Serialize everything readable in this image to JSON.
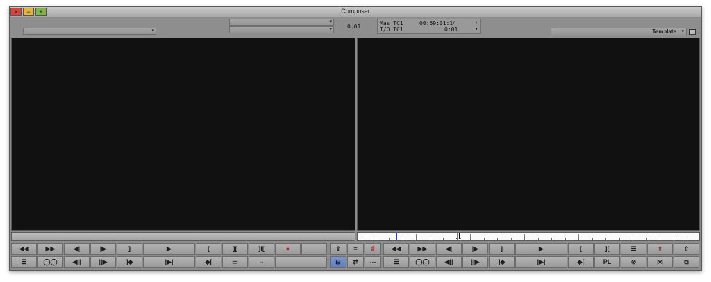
{
  "window": {
    "title": "Composer",
    "close_glyph": "×",
    "minimize_glyph": "−",
    "zoom_glyph": "+"
  },
  "topbar": {
    "source_menu_arrow": "▾",
    "record_menu_arrow": "▾",
    "center_timecode": "0:01",
    "tc1_label": "Mas TC1",
    "tc1_value": "00:59:01:14",
    "tc2_label": "I/O TC1",
    "tc2_value": "0:01",
    "template_label": "Template",
    "template_arrow": "▾"
  },
  "position_bar": {
    "mark_glyph": "][",
    "tick_count": 25
  },
  "source_buttons_row1": [
    {
      "name": "rewind-button",
      "glyph": "◀◀",
      "w": 38
    },
    {
      "name": "fast-forward-button",
      "glyph": "▶▶",
      "w": 38
    },
    {
      "name": "step-back-one-frame-button",
      "glyph": "◀|",
      "w": 38
    },
    {
      "name": "step-forward-one-frame-button",
      "glyph": "|▶",
      "w": 38
    },
    {
      "name": "mark-out-button",
      "glyph": "]",
      "w": 38
    },
    {
      "name": "play-button",
      "glyph": "▶",
      "w": 76
    },
    {
      "name": "mark-in-button",
      "glyph": "[",
      "w": 38
    },
    {
      "name": "mark-clip-button",
      "glyph": "][",
      "w": 38
    },
    {
      "name": "clear-marks-button",
      "glyph": "]I[",
      "w": 38
    },
    {
      "name": "record-button",
      "glyph": "●",
      "w": 38,
      "red": true
    },
    {
      "name": "source-spacer-button",
      "glyph": "",
      "w": 38
    }
  ],
  "source_buttons_row2": [
    {
      "name": "clip-list-button",
      "glyph": "☷",
      "w": 38
    },
    {
      "name": "link-button",
      "glyph": "◯◯",
      "w": 38
    },
    {
      "name": "jog-back-button",
      "glyph": "◀||",
      "w": 38
    },
    {
      "name": "jog-forward-button",
      "glyph": "||▶",
      "w": 38
    },
    {
      "name": "go-to-out-button",
      "glyph": "]◆",
      "w": 38
    },
    {
      "name": "go-to-mark-out-button",
      "glyph": "|▶|",
      "w": 76
    },
    {
      "name": "go-to-in-button",
      "glyph": "◆[",
      "w": 38
    },
    {
      "name": "trim-mode-button",
      "glyph": "▭",
      "w": 38
    },
    {
      "name": "expand-button",
      "glyph": "⇔",
      "w": 38
    },
    {
      "name": "source-blank-button",
      "glyph": "",
      "w": 76
    }
  ],
  "center_buttons_row1": [
    {
      "name": "splice-in-button",
      "glyph": "⇪",
      "w": 25
    },
    {
      "name": "lift-button",
      "glyph": "≡",
      "w": 25
    },
    {
      "name": "overwrite-button",
      "glyph": "⇫",
      "w": 25,
      "red": true
    }
  ],
  "center_buttons_row2": [
    {
      "name": "source-record-toggle-button",
      "glyph": "⊟",
      "w": 25,
      "active": true
    },
    {
      "name": "sync-lock-button",
      "glyph": "⇄",
      "w": 25
    },
    {
      "name": "settings-button",
      "glyph": "⋯",
      "w": 25
    }
  ],
  "record_buttons_row1": [
    {
      "name": "record-rewind-button",
      "glyph": "◀◀",
      "w": 38
    },
    {
      "name": "record-fast-forward-button",
      "glyph": "▶▶",
      "w": 38
    },
    {
      "name": "record-step-back-button",
      "glyph": "◀|",
      "w": 38
    },
    {
      "name": "record-step-forward-button",
      "glyph": "|▶",
      "w": 38
    },
    {
      "name": "record-mark-out-button",
      "glyph": "]",
      "w": 38
    },
    {
      "name": "record-play-button",
      "glyph": "▶",
      "w": 76
    },
    {
      "name": "record-mark-in-button",
      "glyph": "[",
      "w": 38
    },
    {
      "name": "record-mark-clip-button",
      "glyph": "][",
      "w": 38
    },
    {
      "name": "record-mixdown-button",
      "glyph": "☰",
      "w": 38
    },
    {
      "name": "extract-button",
      "glyph": "⇧",
      "w": 38,
      "red": true
    },
    {
      "name": "lift-up-button",
      "glyph": "⇧",
      "w": 38
    }
  ],
  "record_buttons_row2": [
    {
      "name": "record-clip-list-button",
      "glyph": "☷",
      "w": 38
    },
    {
      "name": "record-link-button",
      "glyph": "◯◯",
      "w": 38
    },
    {
      "name": "record-jog-back-button",
      "glyph": "◀||",
      "w": 38
    },
    {
      "name": "record-jog-forward-button",
      "glyph": "||▶",
      "w": 38
    },
    {
      "name": "record-go-to-out-button",
      "glyph": "]◆",
      "w": 38
    },
    {
      "name": "record-go-to-mark-out-button",
      "glyph": "|▶|",
      "w": 76
    },
    {
      "name": "record-go-to-in-button",
      "glyph": "◆[",
      "w": 38
    },
    {
      "name": "pl-button",
      "glyph": "PL",
      "w": 38
    },
    {
      "name": "prohibit-button",
      "glyph": "⊘",
      "w": 38
    },
    {
      "name": "split-button",
      "glyph": "⋈",
      "w": 38
    },
    {
      "name": "copy-button",
      "glyph": "⧉",
      "w": 38
    }
  ]
}
